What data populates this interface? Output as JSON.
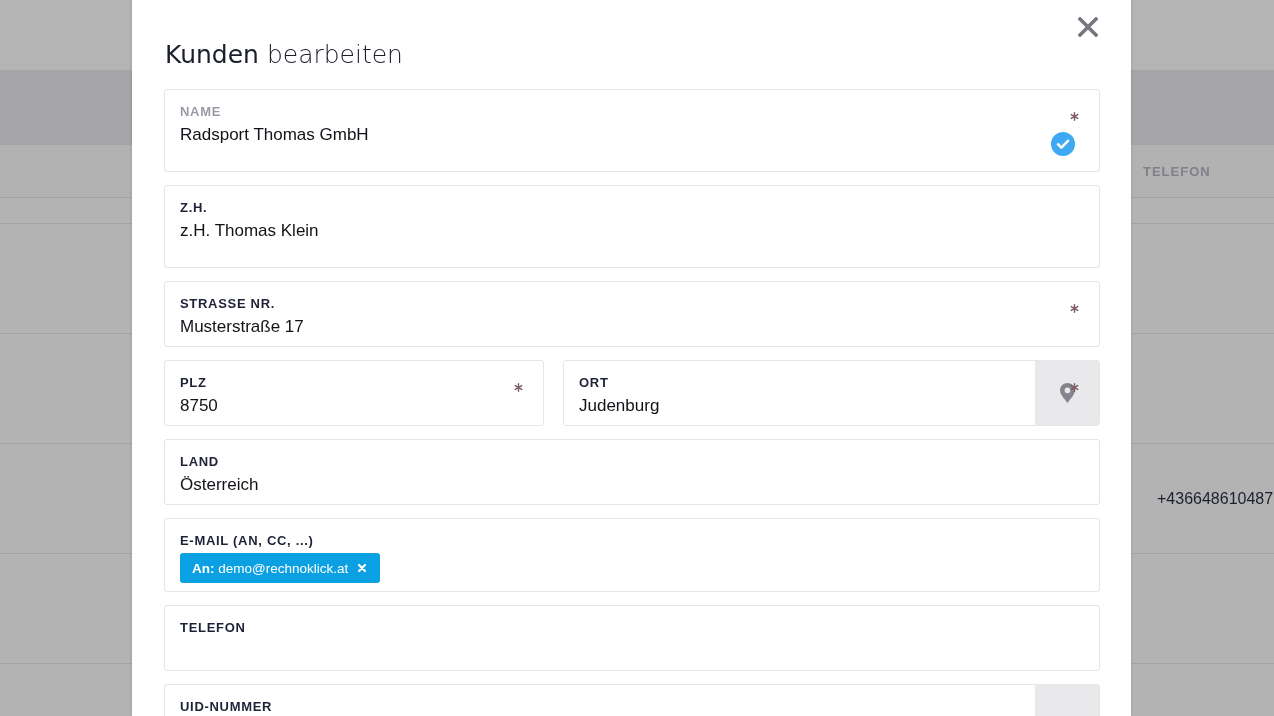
{
  "page": {
    "table": {
      "columns": [
        "TELEFON"
      ],
      "rows": [
        {
          "telefon": "+436648610487"
        }
      ]
    }
  },
  "dialog": {
    "title": "**Kunden** bearbeiten",
    "rows": [
      {
        "fields": [
          {
            "kind": "textarea",
            "label": "NAME",
            "value": "Radsport Thomas GmbH",
            "required": true,
            "valid": true
          }
        ]
      },
      {
        "fields": [
          {
            "kind": "textarea",
            "label": "Z.H.",
            "value": "z.H. Thomas Klein",
            "required": false,
            "valid": false
          }
        ]
      },
      {
        "fields": [
          {
            "kind": "text",
            "label": "STRASSE NR.",
            "value": "Musterstraße 17",
            "required": true,
            "valid": false
          }
        ]
      },
      {
        "fields": [
          {
            "kind": "text",
            "label": "PLZ",
            "value": "8750",
            "required": true,
            "valid": false
          },
          {
            "kind": "location",
            "label": "ORT",
            "value": "Judenburg",
            "required": true,
            "valid": false
          }
        ]
      },
      {
        "fields": [
          {
            "kind": "text",
            "label": "LAND",
            "value": "Österreich",
            "required": false,
            "valid": false
          }
        ]
      },
      {
        "fields": [
          {
            "kind": "tags",
            "label": "E-MAIL (AN, CC, ...)",
            "tags": [
              {
                "text": "**An:** demo@rechnoklick.at"
              }
            ],
            "required": false,
            "valid": false
          }
        ]
      },
      {
        "fields": [
          {
            "kind": "text",
            "label": "TELEFON",
            "required": false,
            "valid": false
          }
        ]
      },
      {
        "fields": [
          {
            "kind": "addon",
            "label": "UID-NUMMER",
            "required": false,
            "valid": false
          }
        ]
      }
    ]
  }
}
